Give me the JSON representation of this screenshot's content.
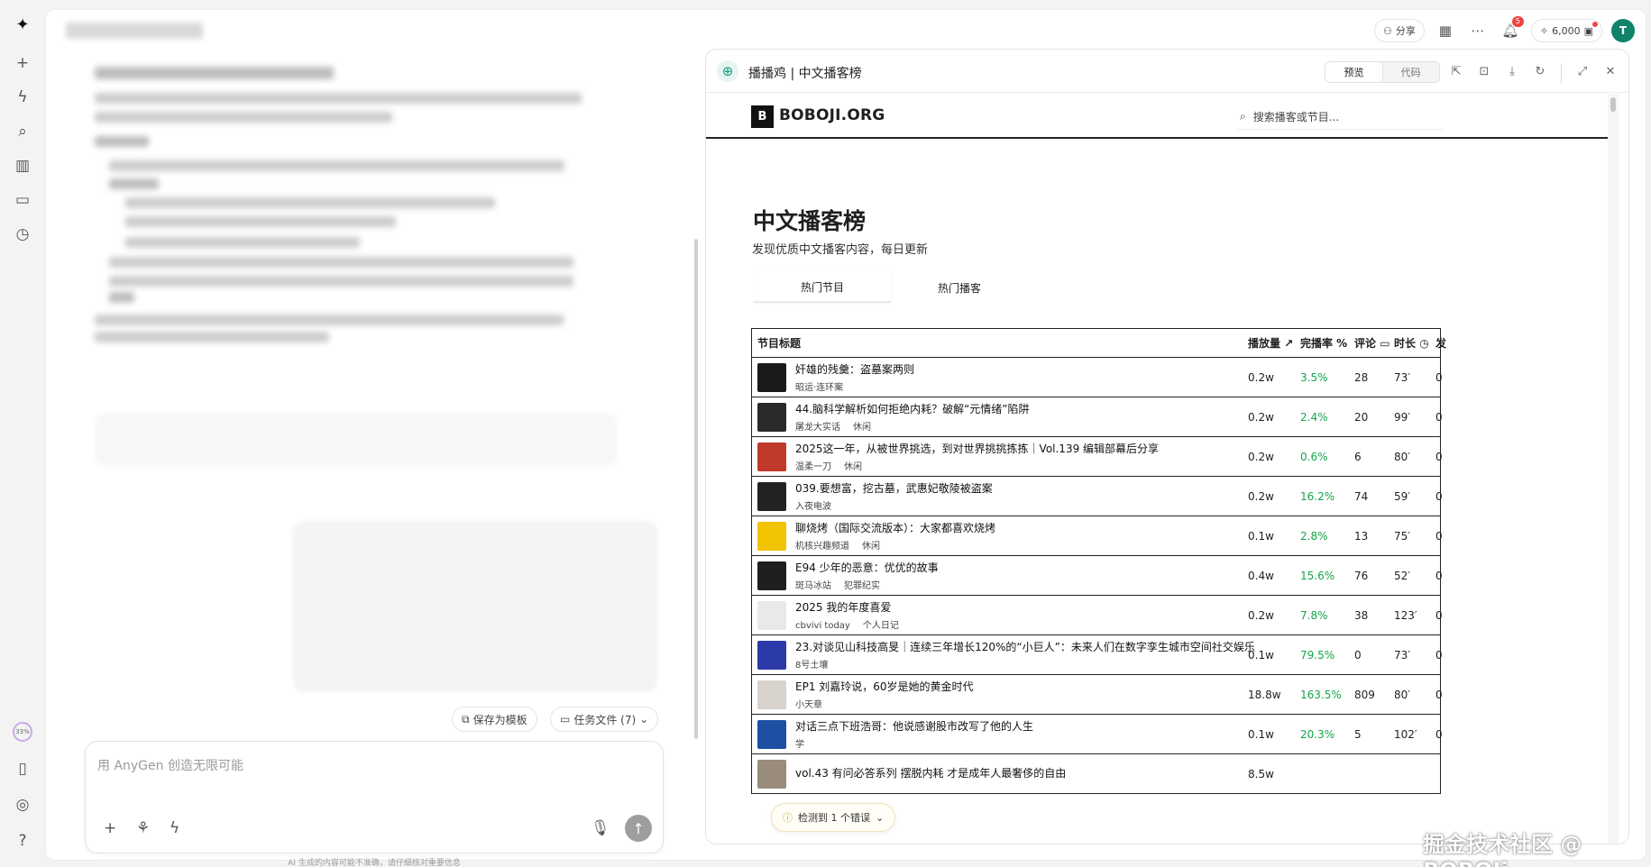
{
  "rail": {
    "progress_label": "33%"
  },
  "topbar": {
    "share_label": "分享",
    "notification_count": "5",
    "credits": "6,000",
    "avatar_initial": "T"
  },
  "actions": {
    "save_template": "保存为模板",
    "task_files": "任务文件 (7)"
  },
  "composer": {
    "placeholder": "用 AnyGen 创造无限可能",
    "disclaimer": "AI 生成的内容可能不准确，请仔细核对重要信息"
  },
  "preview": {
    "title": "播播鸡 | 中文播客榜",
    "mode_preview": "预览",
    "mode_code": "代码"
  },
  "site": {
    "brand_letter": "B",
    "brand": "BOBOJI.ORG",
    "search_placeholder": "搜索播客或节目...",
    "heading": "中文播客榜",
    "subheading": "发现优质中文播客内容，每日更新",
    "tabs": [
      "热门节目",
      "热门播客"
    ],
    "columns": {
      "title": "节目标题",
      "plays": "播放量",
      "completion": "完播率 %",
      "comments": "评论",
      "duration": "时长",
      "more": "发"
    },
    "rows": [
      {
        "title": "奸雄的残羹：盗墓案两则",
        "podcast": "昭运·连环案",
        "tag": "",
        "plays": "0.2w",
        "rate": "3.5%",
        "comments": "28",
        "duration": "73′",
        "more": "0",
        "thumb_color": "#1a1a1a"
      },
      {
        "title": "44.脑科学解析如何拒绝内耗？破解“元情绪”陷阱",
        "podcast": "屠龙大实话",
        "tag": "休闲",
        "plays": "0.2w",
        "rate": "2.4%",
        "comments": "20",
        "duration": "99′",
        "more": "0",
        "thumb_color": "#2a2a2a"
      },
      {
        "title": "2025这一年，从被世界挑选，到对世界挑挑拣拣｜Vol.139 编辑部幕后分享",
        "podcast": "温柔一刀",
        "tag": "休闲",
        "plays": "0.2w",
        "rate": "0.6%",
        "comments": "6",
        "duration": "80′",
        "more": "0",
        "thumb_color": "#c0392b"
      },
      {
        "title": "039.要想富，挖古墓，武惠妃敬陵被盗案",
        "podcast": "入夜电波",
        "tag": "",
        "plays": "0.2w",
        "rate": "16.2%",
        "comments": "74",
        "duration": "59′",
        "more": "0",
        "thumb_color": "#222222"
      },
      {
        "title": "聊烧烤（国际交流版本）：大家都喜欢烧烤",
        "podcast": "机核兴趣频道",
        "tag": "休闲",
        "plays": "0.1w",
        "rate": "2.8%",
        "comments": "13",
        "duration": "75′",
        "more": "0",
        "thumb_color": "#f2c300"
      },
      {
        "title": "E94 少年的恶意：优优的故事",
        "podcast": "斑马冰站",
        "tag": "犯罪纪实",
        "plays": "0.4w",
        "rate": "15.6%",
        "comments": "76",
        "duration": "52′",
        "more": "0",
        "thumb_color": "#1f1f1f"
      },
      {
        "title": "2025 我的年度喜爱",
        "podcast": "cbvivi today",
        "tag": "个人日记",
        "plays": "0.2w",
        "rate": "7.8%",
        "comments": "38",
        "duration": "123′",
        "more": "0",
        "thumb_color": "#e9e9e9"
      },
      {
        "title": "23.对谈见山科技高旻｜连续三年增长120%的“小巨人”：未来人们在数字孪生城市空间社交娱乐",
        "podcast": "8号土壤",
        "tag": "",
        "plays": "0.1w",
        "rate": "79.5%",
        "comments": "0",
        "duration": "73′",
        "more": "0",
        "thumb_color": "#2b3aa8"
      },
      {
        "title": "EP1 刘嘉玲说，60岁是她的黄金时代",
        "podcast": "小天章",
        "tag": "",
        "plays": "18.8w",
        "rate": "163.5%",
        "comments": "809",
        "duration": "80′",
        "more": "0",
        "thumb_color": "#d8d2cc"
      },
      {
        "title": "对话三点下班浩哥：他说感谢股市改写了他的人生",
        "podcast": "学",
        "tag": "",
        "plays": "0.1w",
        "rate": "20.3%",
        "comments": "5",
        "duration": "102′",
        "more": "0",
        "thumb_color": "#1e4fa3"
      },
      {
        "title": "vol.43 有问必答系列 摆脱内耗 才是成年人最奢侈的自由",
        "podcast": "",
        "tag": "",
        "plays": "8.5w",
        "rate": "",
        "comments": "",
        "duration": "",
        "more": "",
        "thumb_color": "#9a8c7a"
      }
    ]
  },
  "error_toast": "检测到 1 个错误",
  "watermark": "掘金技术社区 @ BOBOJi"
}
